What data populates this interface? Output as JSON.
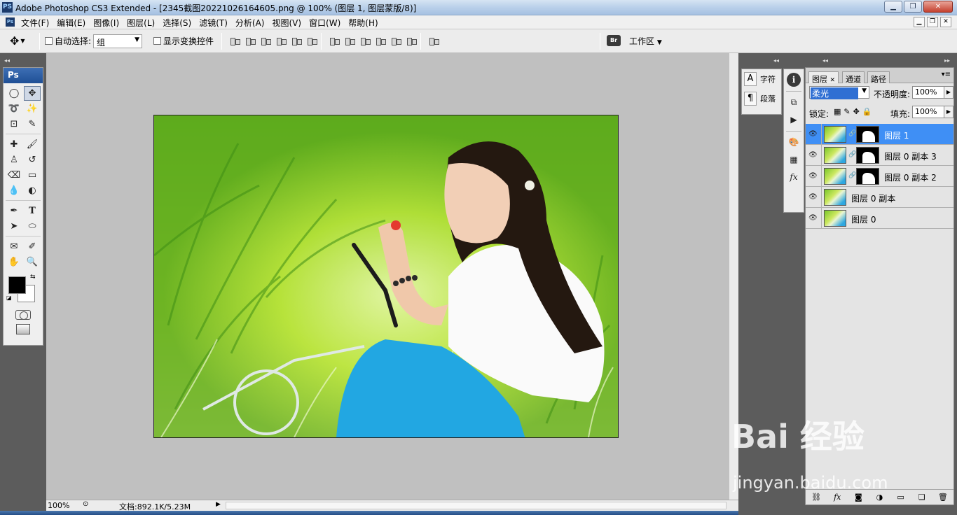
{
  "window": {
    "app_icon": "PS",
    "title": "Adobe Photoshop CS3 Extended - [2345截图20221026164605.png @ 100% (图层 1, 图层蒙版/8)]",
    "controls": [
      "minimize-icon",
      "maximize-icon",
      "close-icon"
    ]
  },
  "menu": {
    "items": [
      "文件(F)",
      "编辑(E)",
      "图像(I)",
      "图层(L)",
      "选择(S)",
      "滤镜(T)",
      "分析(A)",
      "视图(V)",
      "窗口(W)",
      "帮助(H)"
    ]
  },
  "options": {
    "auto_select_label": "自动选择:",
    "auto_select_value": "组",
    "show_transform_label": "显示变换控件",
    "workspace_label": "工作区"
  },
  "toolbox": {
    "header": "Ps",
    "foreground_color": "#000000",
    "background_color": "#ffffff"
  },
  "document": {
    "description_icon": "photo-girl-in-grass"
  },
  "status": {
    "zoom": "100%",
    "doc_info": "文档:892.1K/5.23M"
  },
  "char_panel": {
    "char_label": "字符",
    "para_label": "段落"
  },
  "layers_panel": {
    "tabs": [
      "图层",
      "通道",
      "路径"
    ],
    "blend_mode": "柔光",
    "opacity_label": "不透明度:",
    "opacity": "100%",
    "lock_label": "锁定:",
    "fill_label": "填充:",
    "fill": "100%",
    "layers": [
      {
        "name": "图层 1",
        "has_mask": true,
        "selected": true
      },
      {
        "name": "图层 0 副本 3",
        "has_mask": true,
        "selected": false
      },
      {
        "name": "图层 0 副本 2",
        "has_mask": true,
        "selected": false
      },
      {
        "name": "图层 0 副本",
        "has_mask": false,
        "selected": false
      },
      {
        "name": "图层 0",
        "has_mask": false,
        "selected": false
      }
    ]
  },
  "watermark": {
    "main": "Bai 经验",
    "sub": "jingyan.baidu.com"
  }
}
